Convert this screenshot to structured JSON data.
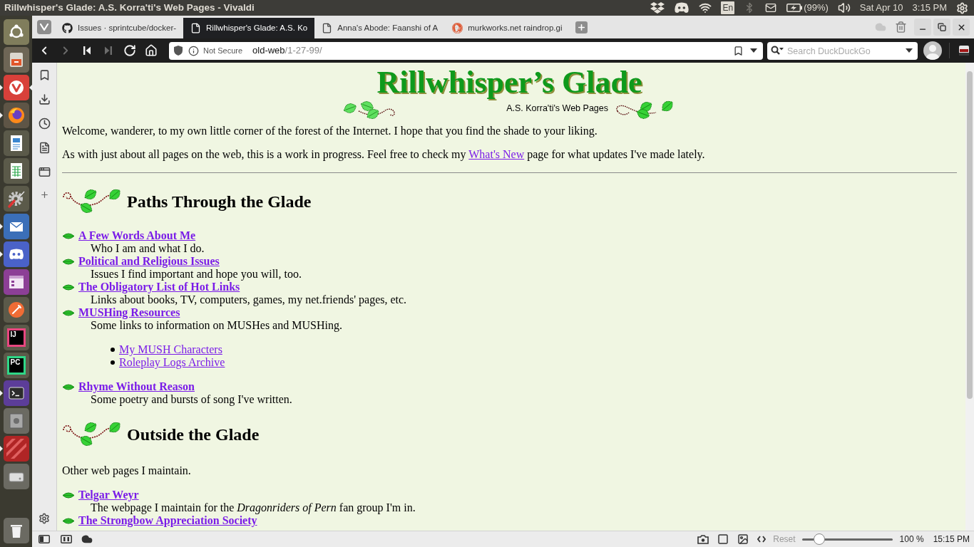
{
  "top_panel": {
    "title": "Rillwhisper's Glade: A.S. Korra'ti's Web Pages - Vivaldi",
    "keyboard_layout": "En",
    "battery": "(99%)",
    "date": "Sat Apr 10",
    "time": "3:15 PM"
  },
  "launcher": {
    "apps": [
      {
        "kind": "ubuntu",
        "running": false,
        "focused": false
      },
      {
        "kind": "files",
        "running": false,
        "focused": false
      },
      {
        "kind": "vivaldi",
        "running": true,
        "focused": true
      },
      {
        "kind": "firefox",
        "running": true,
        "focused": false
      },
      {
        "kind": "writer",
        "running": false,
        "focused": false
      },
      {
        "kind": "calc",
        "running": false,
        "focused": false
      },
      {
        "kind": "settings",
        "running": false,
        "focused": false
      },
      {
        "kind": "thunderbird",
        "running": true,
        "focused": false
      },
      {
        "kind": "discord",
        "running": true,
        "focused": false
      },
      {
        "kind": "purple",
        "running": false,
        "focused": false
      },
      {
        "kind": "postman",
        "running": false,
        "focused": false
      },
      {
        "kind": "intellij",
        "label": "IJ",
        "running": false,
        "focused": false
      },
      {
        "kind": "pycharm",
        "label": "PC",
        "running": false,
        "focused": false
      },
      {
        "kind": "terminal",
        "running": true,
        "focused": false
      },
      {
        "kind": "safe",
        "running": false,
        "focused": false
      },
      {
        "kind": "stripes",
        "running": true,
        "focused": false
      },
      {
        "kind": "disk",
        "running": false,
        "focused": false
      },
      {
        "kind": "trash",
        "running": false,
        "focused": false
      }
    ]
  },
  "tabs": [
    {
      "title": "Issues · sprintcube/docker-",
      "kind": "github",
      "selected": false
    },
    {
      "title": "Rillwhisper's Glade: A.S. Ko",
      "kind": "page",
      "selected": true
    },
    {
      "title": "Anna's Abode: Faanshi of A",
      "kind": "page",
      "selected": false
    },
    {
      "title": "murkworks.net raindrop.gi",
      "kind": "duckduckgo",
      "selected": false
    }
  ],
  "toolbar": {
    "nav_buttons": [
      {
        "kind": "back",
        "disabled": false
      },
      {
        "kind": "forward",
        "disabled": true
      },
      {
        "kind": "rewind",
        "disabled": false
      },
      {
        "kind": "fast_forward",
        "disabled": true
      },
      {
        "kind": "reload",
        "disabled": false
      },
      {
        "kind": "home",
        "disabled": false
      }
    ],
    "address": {
      "security": "Not Secure",
      "host": "old-web",
      "path": "/1-27-99/"
    },
    "search": {
      "placeholder": "Search DuckDuckGo"
    }
  },
  "page": {
    "logo": {
      "title": "Rillwhisper’s Glade",
      "subtitle": "A.S. Korra'ti's Web Pages"
    },
    "intro": "Welcome, wanderer, to my own little corner of the forest of the Internet. I hope that you find the shade to your liking.",
    "whats_new": {
      "before": "As with just about all pages on the web, this is a work in progress. Feel free to check my ",
      "link": "What's New",
      "after": " page for what updates I've made lately."
    },
    "sections": [
      {
        "heading": "Paths Through the Glade",
        "items": [
          {
            "link": "A Few Words About Me",
            "description": "Who I am and what I do."
          },
          {
            "link": "Political and Religious Issues",
            "description": "Issues I find important and hope you will, too."
          },
          {
            "link": "The Obligatory List of Hot Links",
            "description": "Links about books, TV, computers, games, my net.friends' pages, etc."
          },
          {
            "link": "MUSHing Resources",
            "description": "Some links to information on MUSHes and MUSHing.",
            "sublinks": [
              "My MUSH Characters",
              "Roleplay Logs Archive"
            ]
          },
          {
            "link": "Rhyme Without Reason",
            "description": "Some poetry and bursts of song I've written."
          }
        ]
      },
      {
        "heading": "Outside the Glade",
        "text": "Other web pages I maintain.",
        "items": [
          {
            "link": "Telgar Weyr",
            "description": "The webpage I maintain for the *Dragonriders of Pern* fan group I'm in."
          },
          {
            "link": "The Strongbow Appreciation Society"
          }
        ]
      }
    ]
  },
  "status_bar": {
    "reset": "Reset",
    "zoom_slider": {
      "level": 0.15
    },
    "zoom": "100 %",
    "clock": "15:15 PM"
  }
}
